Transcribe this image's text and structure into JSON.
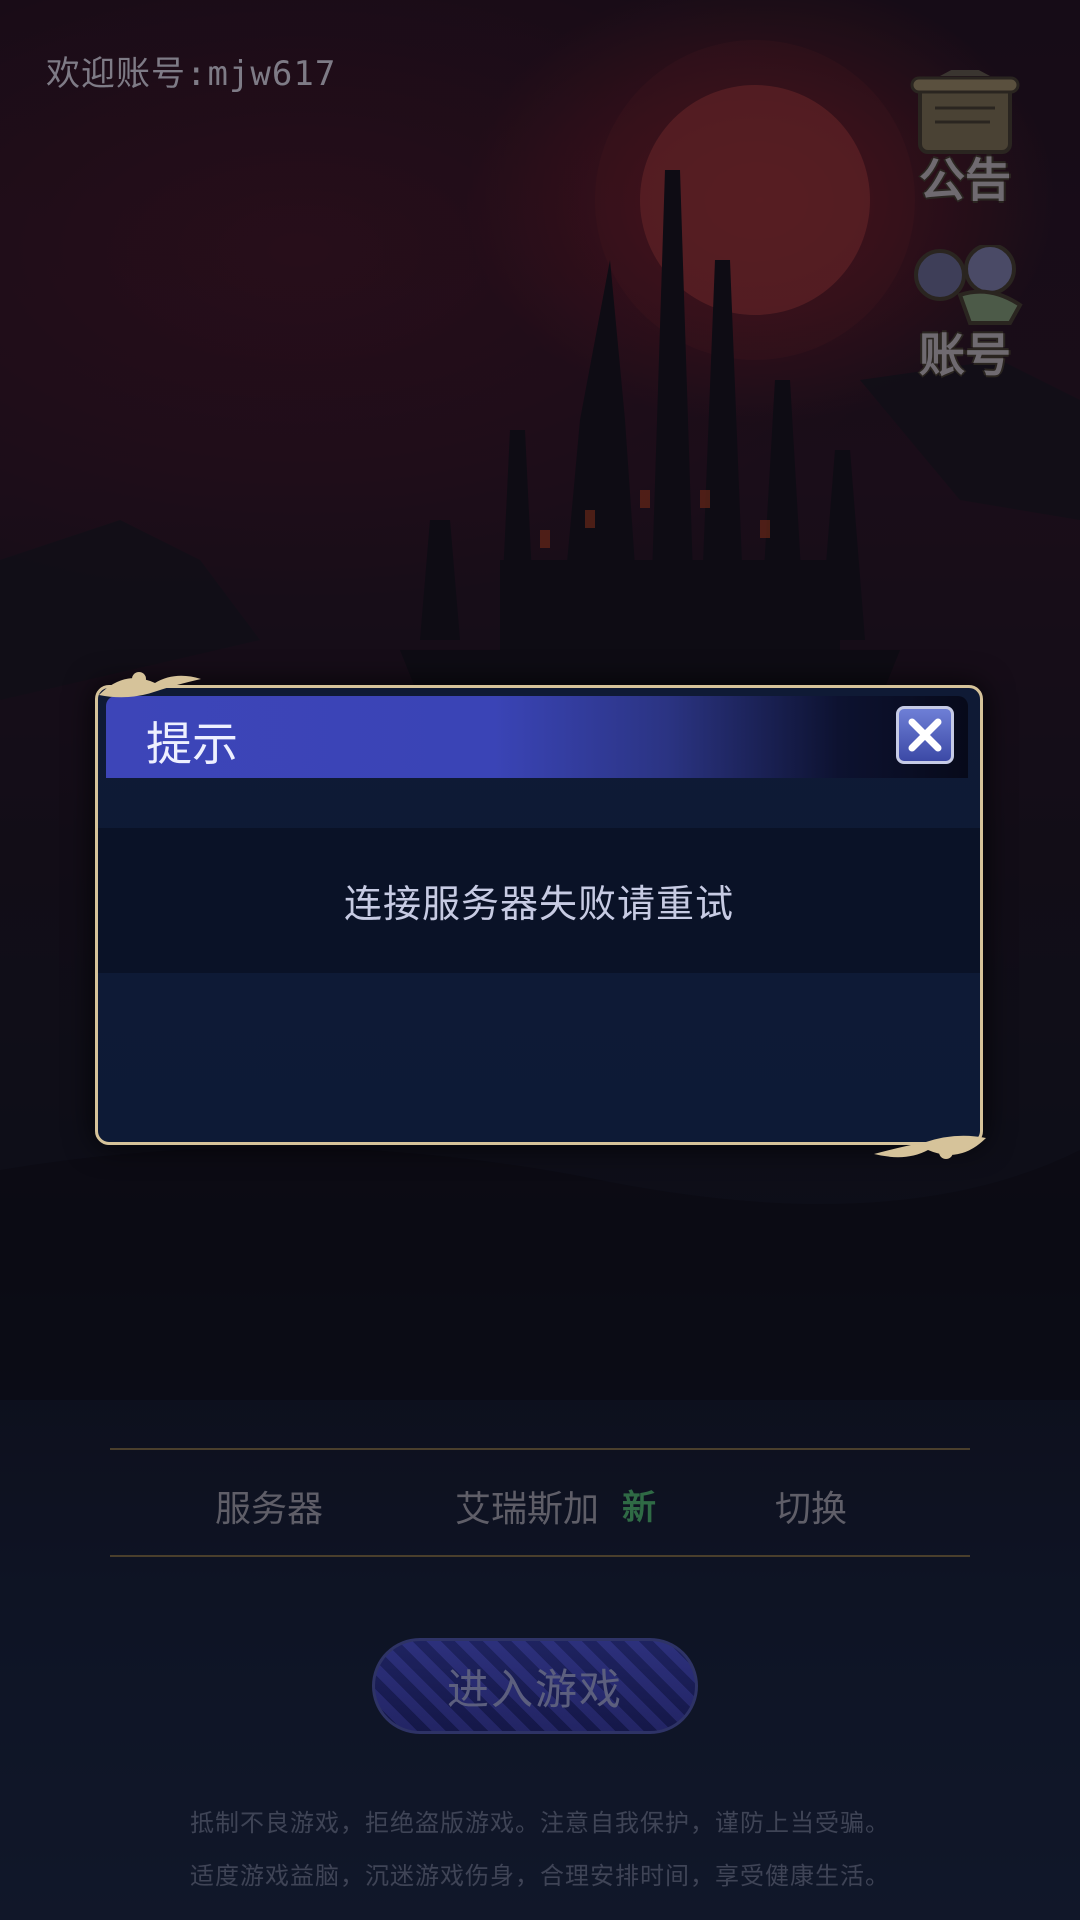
{
  "header": {
    "welcome_text": "欢迎账号:mjw617"
  },
  "side_buttons": {
    "notice_label": "公告",
    "account_label": "账号"
  },
  "dialog": {
    "title": "提示",
    "message": "连接服务器失败请重试",
    "close_icon": "close-x-icon"
  },
  "server_bar": {
    "label": "服务器",
    "server_name": "艾瑞斯加",
    "new_badge": "新",
    "switch_label": "切换"
  },
  "enter_button": {
    "label": "进入游戏"
  },
  "footer": {
    "line1": "抵制不良游戏，拒绝盗版游戏。注意自我保护，谨防上当受骗。",
    "line2": "适度游戏益脑，沉迷游戏伤身，合理安排时间，享受健康生活。"
  },
  "colors": {
    "dialog_border": "#d6c39a",
    "header_blue": "#3d45b8",
    "moon_red": "#a83a3a"
  }
}
